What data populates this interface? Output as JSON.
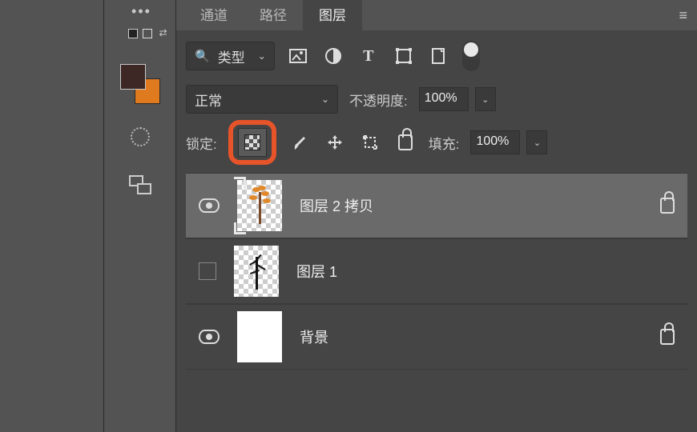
{
  "tabs": {
    "channels": "通道",
    "paths": "路径",
    "layers": "图层"
  },
  "filter": {
    "label": "类型"
  },
  "blend": {
    "mode": "正常",
    "opacity_label": "不透明度:",
    "opacity_value": "100%"
  },
  "lock": {
    "label": "锁定:",
    "fill_label": "填充:",
    "fill_value": "100%"
  },
  "layers_list": [
    {
      "name": "图层 2 拷贝",
      "locked": true,
      "visible": true
    },
    {
      "name": "图层 1",
      "locked": false,
      "visible": false
    },
    {
      "name": "背景",
      "locked": true,
      "visible": true
    }
  ],
  "colors": {
    "foreground": "#3d2825",
    "background_swatch": "#e07a1f",
    "highlight": "#e8542a"
  }
}
